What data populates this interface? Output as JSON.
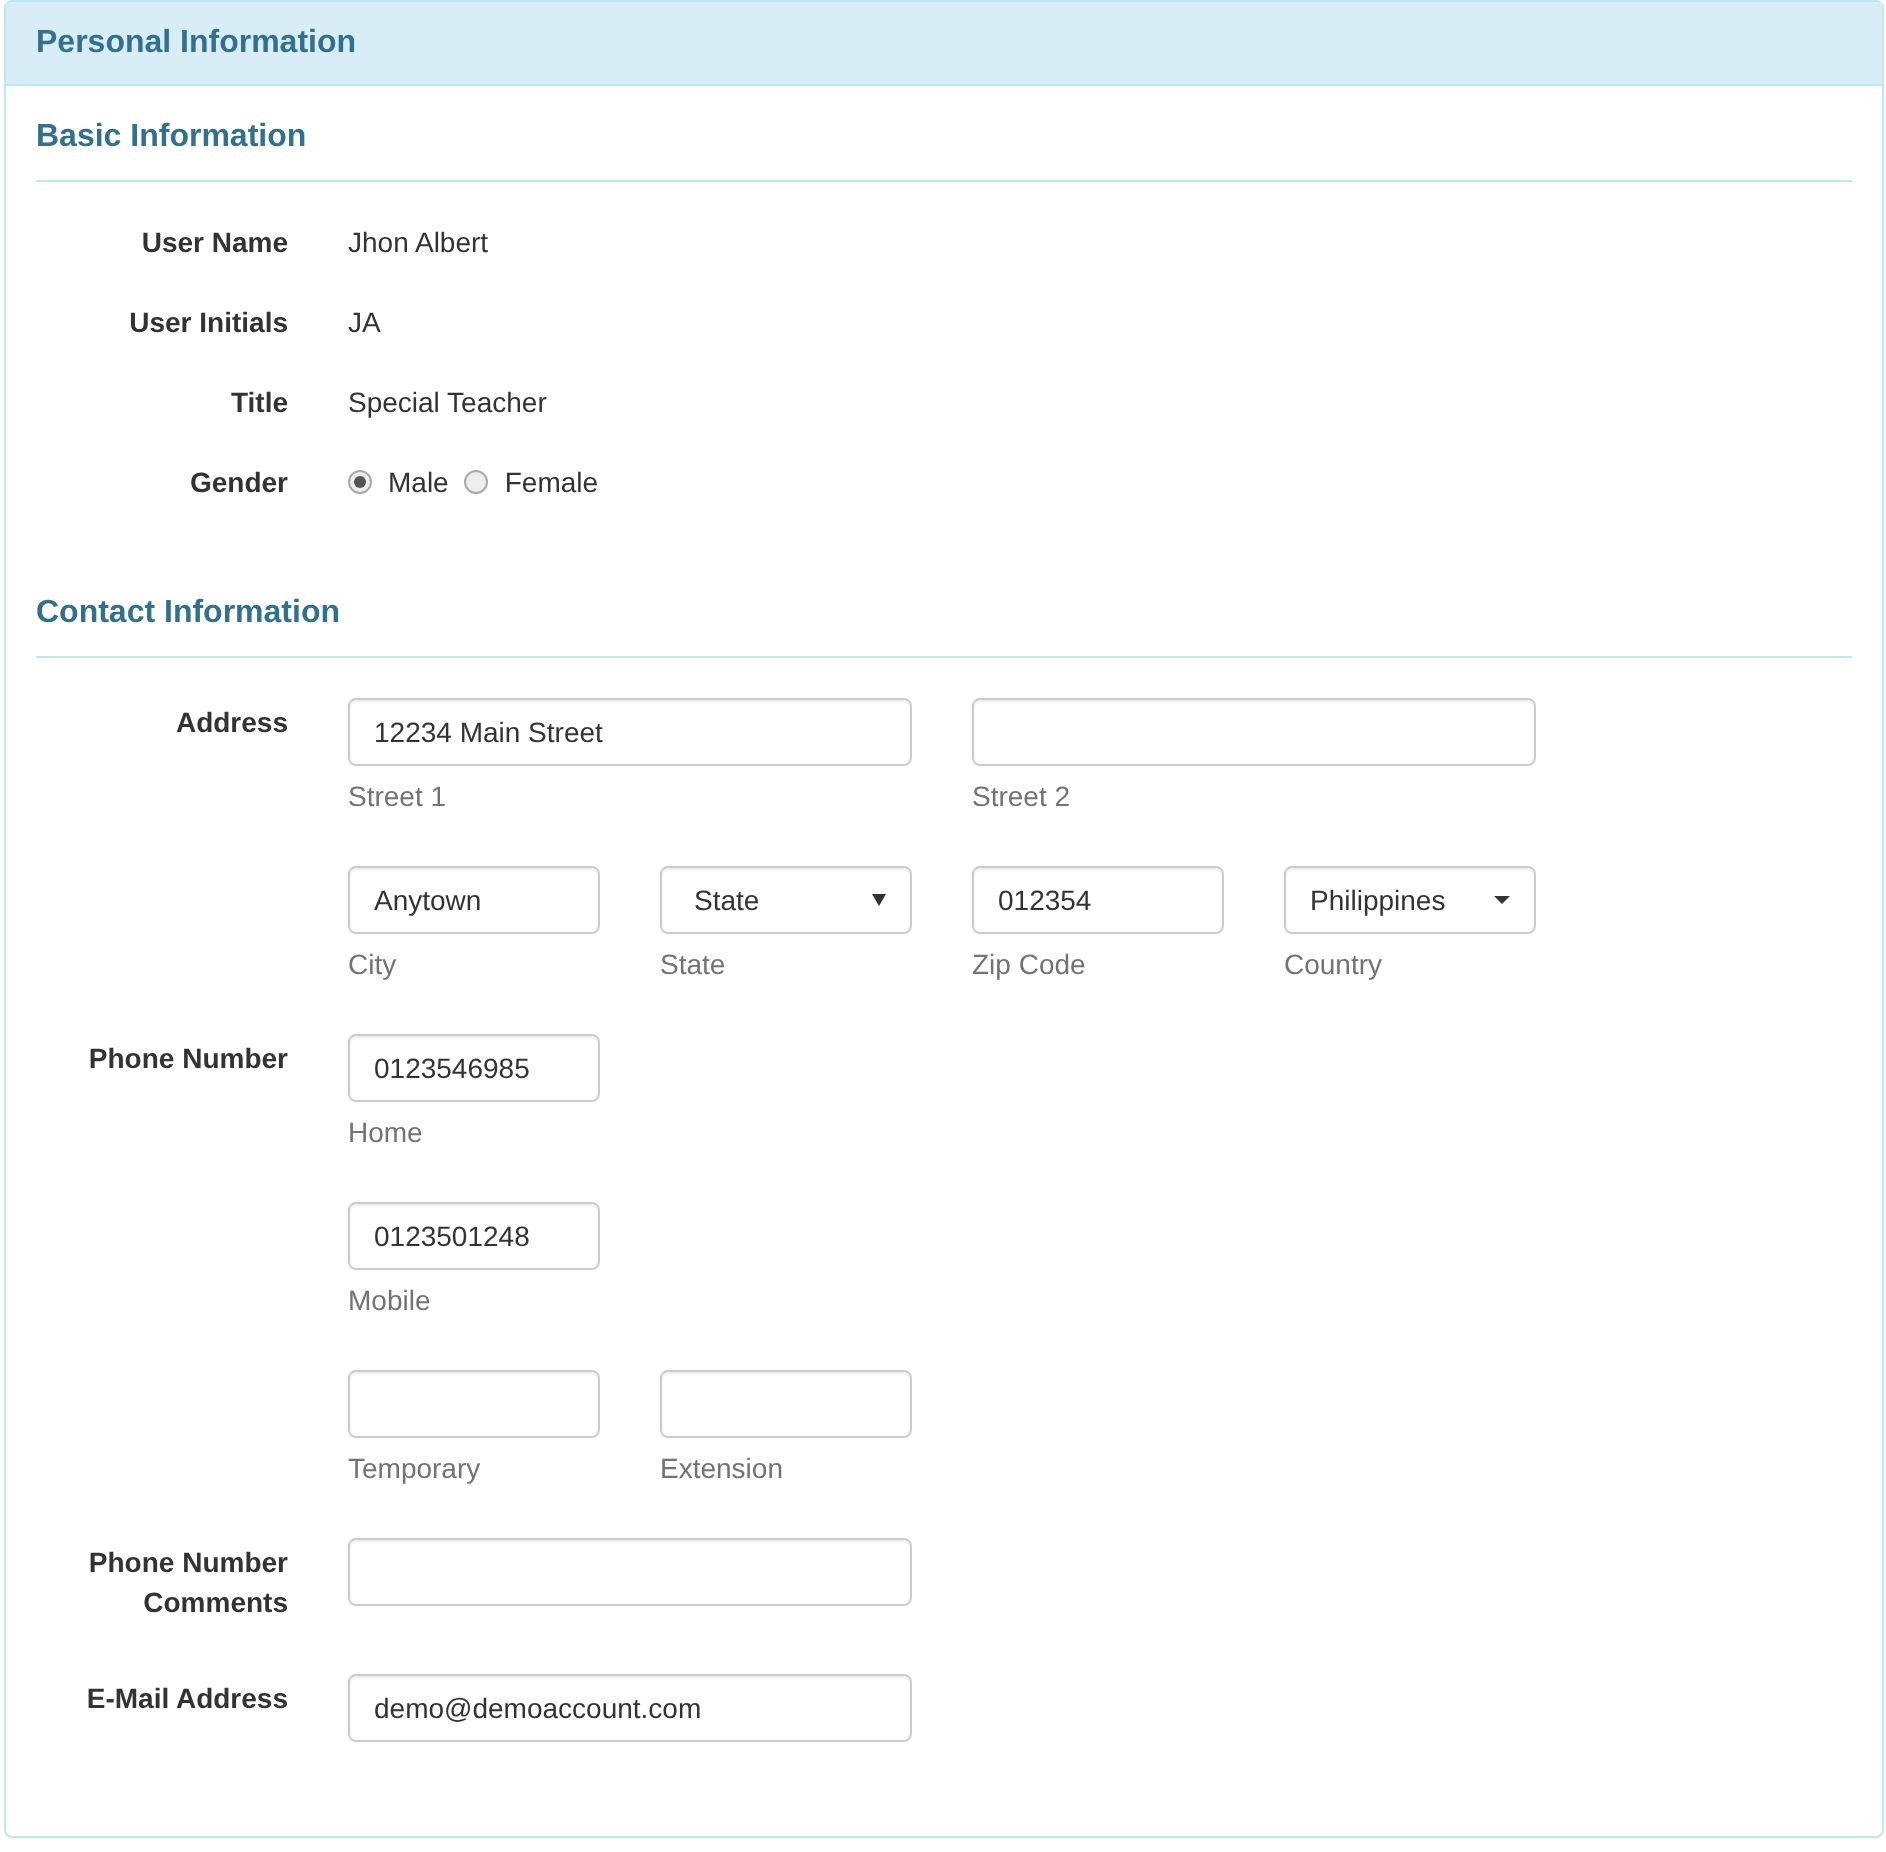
{
  "panel": {
    "title": "Personal Information"
  },
  "sections": [
    {
      "heading": "Basic Information",
      "fields": [
        {
          "kind": "text",
          "label": "User Name",
          "value": "Jhon Albert"
        },
        {
          "kind": "text",
          "label": "User Initials",
          "value": "JA"
        },
        {
          "kind": "text",
          "label": "Title",
          "value": "Special Teacher"
        },
        {
          "kind": "radio",
          "label": "Gender",
          "options": [
            {
              "label": "Male",
              "selected": true
            },
            {
              "label": "Female",
              "selected": false
            }
          ]
        }
      ]
    },
    {
      "heading": "Contact Information",
      "fields": [
        {
          "kind": "inputs",
          "label": "Address",
          "rows": [
            {
              "inputs": [
                {
                  "kind": "wide-input",
                  "value": "12234 Main Street",
                  "help": "Street 1"
                },
                {
                  "kind": "wide-input",
                  "help": "Street 2"
                }
              ]
            },
            {
              "inputs": [
                {
                  "kind": "input",
                  "value": "Anytown",
                  "help": "City"
                },
                {
                  "kind": "native-select",
                  "value": "State",
                  "help": "State"
                },
                {
                  "kind": "input",
                  "value": "012354",
                  "help": "Zip Code"
                },
                {
                  "kind": "dropdown",
                  "value": "Philippines",
                  "help": "Country"
                }
              ]
            }
          ]
        },
        {
          "kind": "inputs",
          "label": "Phone Number",
          "rows": [
            {
              "inputs": [
                {
                  "kind": "input",
                  "value": "0123546985",
                  "help": "Home"
                }
              ]
            },
            {
              "inputs": [
                {
                  "kind": "input",
                  "value": "0123501248",
                  "help": "Mobile"
                }
              ]
            },
            {
              "inputs": [
                {
                  "kind": "input",
                  "help": "Temporary"
                },
                {
                  "kind": "input",
                  "help": "Extension"
                }
              ]
            }
          ]
        },
        {
          "kind": "inputs",
          "label": "Phone Number Comments",
          "rows": [
            {
              "inputs": [
                {
                  "kind": "wide-input"
                }
              ]
            }
          ]
        },
        {
          "kind": "inputs",
          "label": "E-Mail Address",
          "rows": [
            {
              "inputs": [
                {
                  "kind": "wide-input",
                  "value": "demo@demoaccount.com"
                }
              ]
            }
          ]
        }
      ]
    }
  ]
}
